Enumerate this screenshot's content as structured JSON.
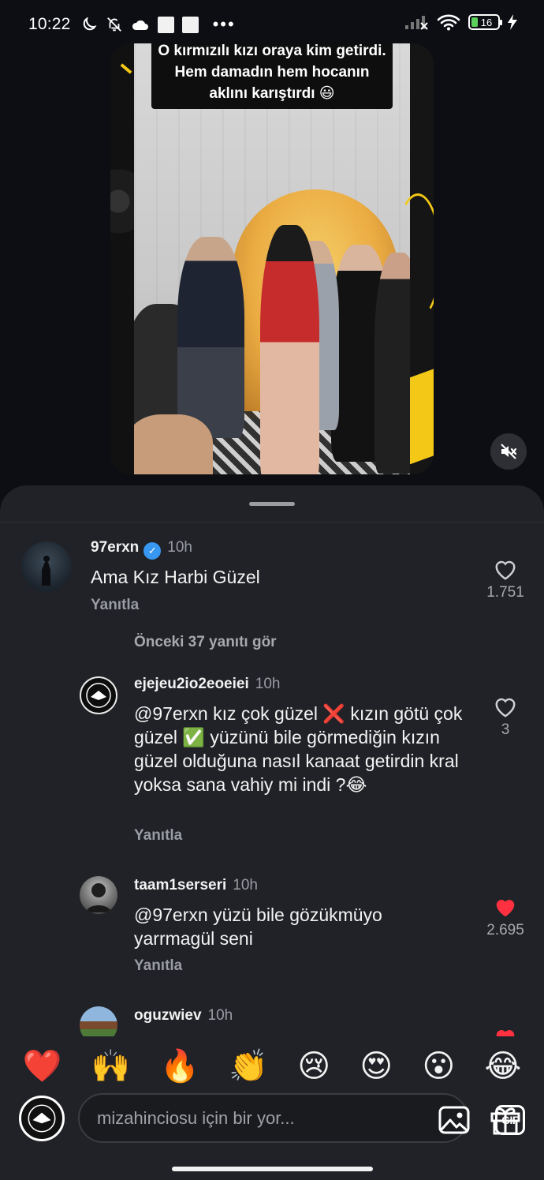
{
  "status_bar": {
    "time": "10:22",
    "battery": "16"
  },
  "video": {
    "caption": "O kırmızılı kızı oraya kim getirdi. Hem damadın hem hocanın aklını karıştırdı 😃"
  },
  "comments": {
    "top": {
      "username": "97erxn",
      "verified": true,
      "time": "10h",
      "text": "Ama Kız Harbi Güzel",
      "reply_label": "Yanıtla",
      "likes": "1.751",
      "liked": false
    },
    "view_more_label": "Önceki 37 yanıtı gör",
    "replies": [
      {
        "username": "ejejeu2io2eoeiei",
        "time": "10h",
        "text": "@97erxn kız çok güzel ❌ kızın götü çok güzel ✅ yüzünü bile görmediğin kızın güzel olduğuna nasıl kanaat getirdin kral yoksa sana vahiy mi indi ?😂",
        "reply_label": "Yanıtla",
        "likes": "3",
        "liked": false
      },
      {
        "username": "taam1serseri",
        "time": "10h",
        "text": "@97erxn yüzü bile gözükmüyo yarrmagül seni",
        "reply_label": "Yanıtla",
        "likes": "2.695",
        "liked": true
      },
      {
        "username": "oguzwiev",
        "time": "10h"
      }
    ]
  },
  "emoji_bar": [
    "❤️",
    "🙌",
    "🔥",
    "👏",
    "😢",
    "😍",
    "😮",
    "😂"
  ],
  "input": {
    "placeholder": "mizahinciosu için bir yor..."
  },
  "colors": {
    "sheet_bg": "#202227",
    "like_red": "#ff3040",
    "verified_blue": "#3897f0",
    "accent_yellow": "#f4c816"
  }
}
